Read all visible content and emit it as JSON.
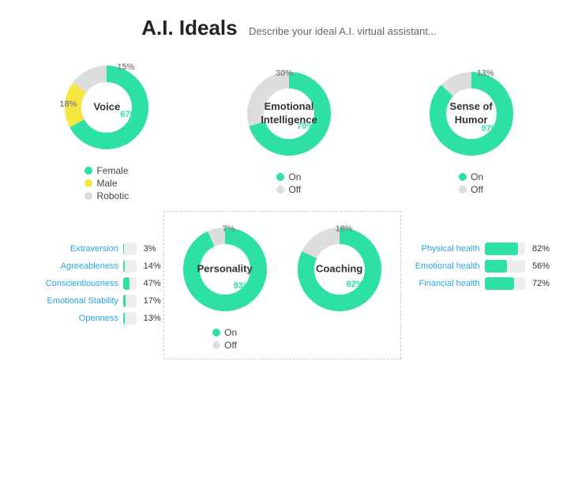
{
  "header": {
    "title": "A.I. Ideals",
    "subtitle": "Describe your ideal A.I. virtual assistant..."
  },
  "charts_row1": [
    {
      "id": "voice",
      "label": "Voice",
      "segments": [
        {
          "pct": 67,
          "color": "#2de0a5",
          "label_pos": "bottom-right"
        },
        {
          "pct": 18,
          "color": "#f5e642",
          "label_pos": "left"
        },
        {
          "pct": 15,
          "color": "#ddd",
          "label_pos": "top-right"
        }
      ],
      "pcts": [
        "67%",
        "18%",
        "15%"
      ],
      "legend": [
        {
          "color": "#2de0a5",
          "label": "Female"
        },
        {
          "color": "#f5e642",
          "label": "Male"
        },
        {
          "color": "#ddd",
          "label": "Robotic"
        }
      ]
    },
    {
      "id": "emotional-intelligence",
      "label": "Emotional\nIntelligence",
      "segments": [
        {
          "pct": 70,
          "color": "#2de0a5"
        },
        {
          "pct": 30,
          "color": "#ddd"
        }
      ],
      "pcts": [
        "70%",
        "30%"
      ],
      "legend": [
        {
          "color": "#2de0a5",
          "label": "On"
        },
        {
          "color": "#ddd",
          "label": "Off"
        }
      ]
    },
    {
      "id": "sense-of-humor",
      "label": "Sense of\nHumor",
      "segments": [
        {
          "pct": 87,
          "color": "#2de0a5"
        },
        {
          "pct": 13,
          "color": "#ddd"
        }
      ],
      "pcts": [
        "87%",
        "13%"
      ],
      "legend": [
        {
          "color": "#2de0a5",
          "label": "On"
        },
        {
          "color": "#ddd",
          "label": "Off"
        }
      ]
    }
  ],
  "charts_row2": [
    {
      "id": "personality",
      "label": "Personality",
      "segments": [
        {
          "pct": 93,
          "color": "#2de0a5"
        },
        {
          "pct": 7,
          "color": "#ddd"
        }
      ],
      "pcts": [
        "93%",
        "7%"
      ],
      "legend": [
        {
          "color": "#2de0a5",
          "label": "On"
        },
        {
          "color": "#ddd",
          "label": "Off"
        }
      ]
    },
    {
      "id": "coaching",
      "label": "Coaching",
      "segments": [
        {
          "pct": 82,
          "color": "#2de0a5"
        },
        {
          "pct": 18,
          "color": "#ddd"
        }
      ],
      "pcts": [
        "82%",
        "18%"
      ],
      "legend": [
        {
          "color": "#2de0a5",
          "label": "On"
        },
        {
          "color": "#ddd",
          "label": "Off"
        }
      ]
    }
  ],
  "personality_bars": [
    {
      "label": "Extraversion",
      "pct": 3,
      "pct_label": "3%"
    },
    {
      "label": "Agreeableness",
      "pct": 14,
      "pct_label": "14%"
    },
    {
      "label": "Conscientiousness",
      "pct": 47,
      "pct_label": "47%"
    },
    {
      "label": "Emotional Stability",
      "pct": 17,
      "pct_label": "17%"
    },
    {
      "label": "Openness",
      "pct": 13,
      "pct_label": "13%"
    }
  ],
  "coaching_bars": [
    {
      "label": "Physical health",
      "pct": 82,
      "pct_label": "82%"
    },
    {
      "label": "Emotional health",
      "pct": 56,
      "pct_label": "56%"
    },
    {
      "label": "Financial health",
      "pct": 72,
      "pct_label": "72%"
    }
  ]
}
